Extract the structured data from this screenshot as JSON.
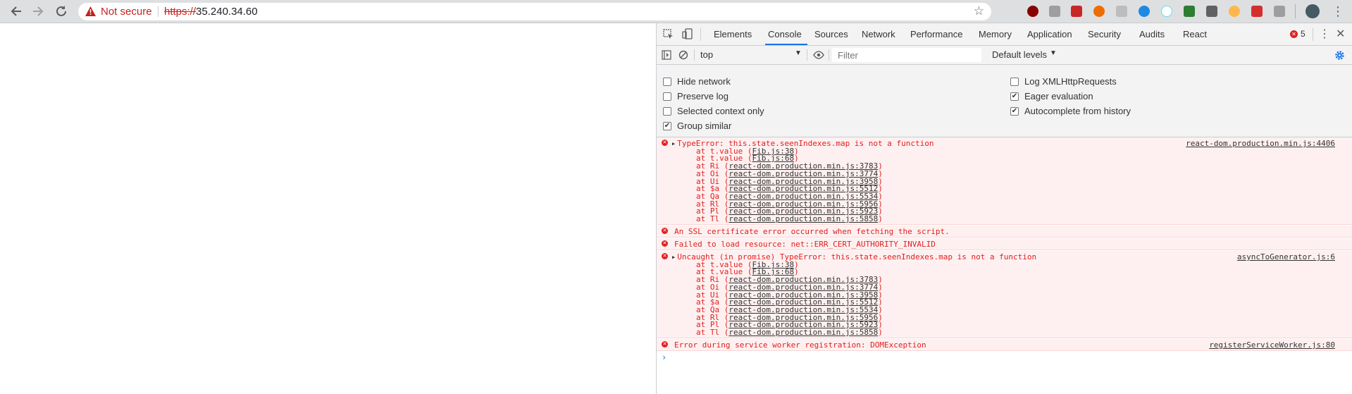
{
  "browser": {
    "security_label": "Not secure",
    "url_scheme": "https://",
    "url_host": "35.240.34.60"
  },
  "devtools": {
    "tabs": [
      "Elements",
      "Console",
      "Sources",
      "Network",
      "Performance",
      "Memory",
      "Application",
      "Security",
      "Audits",
      "React"
    ],
    "active_tab": "Console",
    "error_count": "5",
    "context": "top",
    "filter_placeholder": "Filter",
    "levels": "Default levels",
    "settings": {
      "hide_network": {
        "label": "Hide network",
        "checked": false
      },
      "preserve_log": {
        "label": "Preserve log",
        "checked": false
      },
      "selected_context": {
        "label": "Selected context only",
        "checked": false
      },
      "group_similar": {
        "label": "Group similar",
        "checked": true
      },
      "log_xhr": {
        "label": "Log XMLHttpRequests",
        "checked": false
      },
      "eager_eval": {
        "label": "Eager evaluation",
        "checked": true
      },
      "autocomplete": {
        "label": "Autocomplete from history",
        "checked": true
      }
    }
  },
  "console": {
    "messages": [
      {
        "text": "TypeError: this.state.seenIndexes.map is not a function",
        "source": "react-dom.production.min.js:4406",
        "stack": [
          {
            "fn": "t.value",
            "loc": "Fib.js:38"
          },
          {
            "fn": "t.value",
            "loc": "Fib.js:68"
          },
          {
            "fn": "Ri",
            "loc": "react-dom.production.min.js:3783"
          },
          {
            "fn": "Oi",
            "loc": "react-dom.production.min.js:3774"
          },
          {
            "fn": "Ui",
            "loc": "react-dom.production.min.js:3958"
          },
          {
            "fn": "$a",
            "loc": "react-dom.production.min.js:5512"
          },
          {
            "fn": "Qa",
            "loc": "react-dom.production.min.js:5534"
          },
          {
            "fn": "Rl",
            "loc": "react-dom.production.min.js:5956"
          },
          {
            "fn": "Pl",
            "loc": "react-dom.production.min.js:5923"
          },
          {
            "fn": "Tl",
            "loc": "react-dom.production.min.js:5858"
          }
        ]
      },
      {
        "text": "An SSL certificate error occurred when fetching the script."
      },
      {
        "text": "Failed to load resource: net::ERR_CERT_AUTHORITY_INVALID"
      },
      {
        "text": "Uncaught (in promise) TypeError: this.state.seenIndexes.map is not a function",
        "source": "asyncToGenerator.js:6",
        "stack": [
          {
            "fn": "t.value",
            "loc": "Fib.js:38"
          },
          {
            "fn": "t.value",
            "loc": "Fib.js:68"
          },
          {
            "fn": "Ri",
            "loc": "react-dom.production.min.js:3783"
          },
          {
            "fn": "Oi",
            "loc": "react-dom.production.min.js:3774"
          },
          {
            "fn": "Ui",
            "loc": "react-dom.production.min.js:3958"
          },
          {
            "fn": "$a",
            "loc": "react-dom.production.min.js:5512"
          },
          {
            "fn": "Qa",
            "loc": "react-dom.production.min.js:5534"
          },
          {
            "fn": "Rl",
            "loc": "react-dom.production.min.js:5956"
          },
          {
            "fn": "Pl",
            "loc": "react-dom.production.min.js:5923"
          },
          {
            "fn": "Tl",
            "loc": "react-dom.production.min.js:5858"
          }
        ]
      },
      {
        "text": "Error during service worker registration: DOMException",
        "source": "registerServiceWorker.js:80"
      }
    ]
  },
  "colors": {
    "error": "#e02020",
    "accent": "#1a73e8"
  }
}
